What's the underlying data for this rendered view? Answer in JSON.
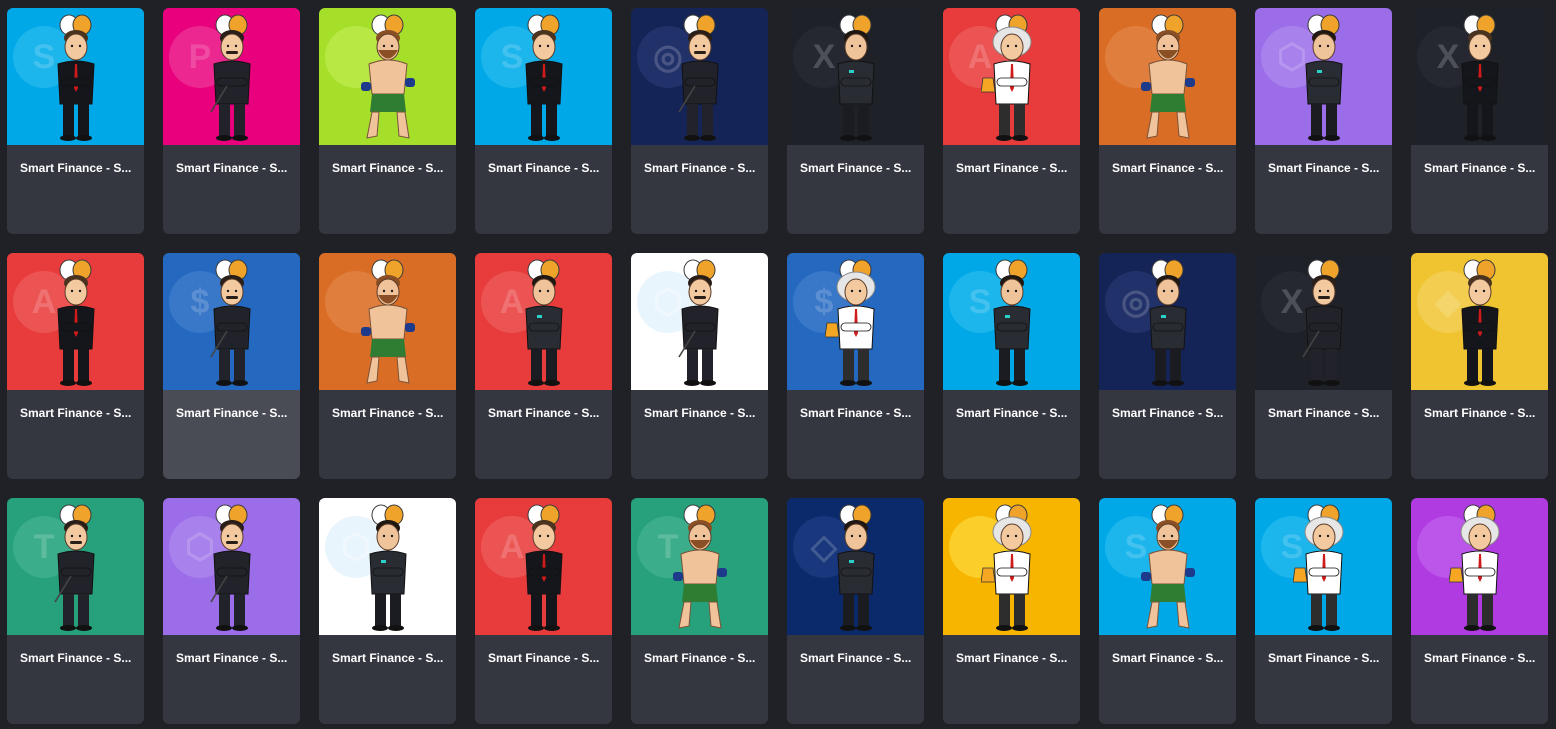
{
  "grid": {
    "title_text": "Smart Finance - S...",
    "items": [
      {
        "bg": "#00a8e8",
        "glow": "#33c2f0",
        "coin": "S",
        "character": "elon",
        "skin": "#f3c9a0",
        "hair": "#4a3420",
        "suit": "#15161b",
        "pants": "#15161b",
        "accent": "#d11a1a"
      },
      {
        "bg": "#e8007d",
        "glow": "#f04aa1",
        "coin": "P",
        "character": "businessman",
        "skin": "#f3c9a0",
        "hair": "#2a1f18",
        "suit": "#22232a",
        "pants": "#22232a",
        "accent": "#1a1a1a"
      },
      {
        "bg": "#a6df2a",
        "glow": "#c5ef59",
        "coin": "",
        "character": "fighter",
        "skin": "#f1c39a",
        "hair": "#8a4f24",
        "suit": "#f1c39a",
        "pants": "#2e7d32",
        "accent": "#1e3a8a"
      },
      {
        "bg": "#00a8e8",
        "glow": "#33c2f0",
        "coin": "S",
        "character": "elon",
        "skin": "#f3c9a0",
        "hair": "#4a3420",
        "suit": "#15161b",
        "pants": "#15161b",
        "accent": "#d11a1a"
      },
      {
        "bg": "#152456",
        "glow": "#2b3d7a",
        "coin": "◎",
        "character": "businessman",
        "skin": "#f3c9a0",
        "hair": "#2a1f18",
        "suit": "#22232a",
        "pants": "#22232a",
        "accent": "#1a1a1a"
      },
      {
        "bg": "#1e2128",
        "glow": "#2b2f37",
        "coin": "X",
        "character": "tech",
        "skin": "#f0c49b",
        "hair": "#1f1712",
        "suit": "#2a2c33",
        "pants": "#1b1c21",
        "accent": "#5f6670"
      },
      {
        "bg": "#e83b3b",
        "glow": "#f06a6a",
        "coin": "A",
        "character": "scientist",
        "skin": "#f3c9a0",
        "hair": "#e6e6e6",
        "suit": "#ffffff",
        "pants": "#2d2d2d",
        "accent": "#d11a1a"
      },
      {
        "bg": "#d96d26",
        "glow": "#e58d52",
        "coin": "",
        "character": "fighter",
        "skin": "#f1c39a",
        "hair": "#8a4f24",
        "suit": "#f1c39a",
        "pants": "#2e7d32",
        "accent": "#1e3a8a"
      },
      {
        "bg": "#9b6de8",
        "glow": "#b392f0",
        "coin": "⬡",
        "character": "tech",
        "skin": "#f0c49b",
        "hair": "#1f1712",
        "suit": "#2a2c33",
        "pants": "#1b1c21",
        "accent": "#5f6670"
      },
      {
        "bg": "#1e2128",
        "glow": "#2b2f37",
        "coin": "X",
        "character": "elon",
        "skin": "#f3c9a0",
        "hair": "#4a3420",
        "suit": "#15161b",
        "pants": "#15161b",
        "accent": "#d11a1a"
      },
      {
        "bg": "#e83b3b",
        "glow": "#f06a6a",
        "coin": "A",
        "character": "elon",
        "skin": "#f3c9a0",
        "hair": "#4a3420",
        "suit": "#15161b",
        "pants": "#15161b",
        "accent": "#d11a1a"
      },
      {
        "bg": "#2468bf",
        "glow": "#4b86d1",
        "coin": "$",
        "character": "businessman",
        "skin": "#f3c9a0",
        "hair": "#2a1f18",
        "suit": "#22232a",
        "pants": "#22232a",
        "accent": "#1a1a1a"
      },
      {
        "bg": "#d96d26",
        "glow": "#e58d52",
        "coin": "",
        "character": "fighter",
        "skin": "#f1c39a",
        "hair": "#8a4f24",
        "suit": "#f1c39a",
        "pants": "#2e7d32",
        "accent": "#1e3a8a"
      },
      {
        "bg": "#e83b3b",
        "glow": "#f06a6a",
        "coin": "A",
        "character": "tech",
        "skin": "#f0c49b",
        "hair": "#1f1712",
        "suit": "#2a2c33",
        "pants": "#1b1c21",
        "accent": "#5f6670"
      },
      {
        "bg": "#ffffff",
        "glow": "#d7eefb",
        "coin": "⬡",
        "character": "businessman",
        "skin": "#f3c9a0",
        "hair": "#2a1f18",
        "suit": "#22232a",
        "pants": "#22232a",
        "accent": "#1a1a1a"
      },
      {
        "bg": "#2468bf",
        "glow": "#4b86d1",
        "coin": "$",
        "character": "scientist",
        "skin": "#f3c9a0",
        "hair": "#e6e6e6",
        "suit": "#ffffff",
        "pants": "#2d2d2d",
        "accent": "#d11a1a"
      },
      {
        "bg": "#00a8e8",
        "glow": "#33c2f0",
        "coin": "S",
        "character": "tech",
        "skin": "#f0c49b",
        "hair": "#1f1712",
        "suit": "#2a2c33",
        "pants": "#1b1c21",
        "accent": "#5f6670"
      },
      {
        "bg": "#152456",
        "glow": "#2b3d7a",
        "coin": "◎",
        "character": "tech",
        "skin": "#f0c49b",
        "hair": "#1f1712",
        "suit": "#2a2c33",
        "pants": "#1b1c21",
        "accent": "#5f6670"
      },
      {
        "bg": "#1e2128",
        "glow": "#2b2f37",
        "coin": "X",
        "character": "businessman",
        "skin": "#f3c9a0",
        "hair": "#2a1f18",
        "suit": "#22232a",
        "pants": "#22232a",
        "accent": "#1a1a1a"
      },
      {
        "bg": "#f0c430",
        "glow": "#f5d66b",
        "coin": "◆",
        "character": "elon",
        "skin": "#f3c9a0",
        "hair": "#4a3420",
        "suit": "#15161b",
        "pants": "#15161b",
        "accent": "#d11a1a"
      },
      {
        "bg": "#26a17b",
        "glow": "#4db897",
        "coin": "T",
        "character": "businessman",
        "skin": "#f3c9a0",
        "hair": "#2a1f18",
        "suit": "#22232a",
        "pants": "#22232a",
        "accent": "#1a1a1a"
      },
      {
        "bg": "#9b6de8",
        "glow": "#b392f0",
        "coin": "⬡",
        "character": "businessman",
        "skin": "#f3c9a0",
        "hair": "#2a1f18",
        "suit": "#22232a",
        "pants": "#22232a",
        "accent": "#1a1a1a"
      },
      {
        "bg": "#ffffff",
        "glow": "#d7eefb",
        "coin": "⬡",
        "character": "tech",
        "skin": "#f0c49b",
        "hair": "#1f1712",
        "suit": "#2a2c33",
        "pants": "#1b1c21",
        "accent": "#5f6670"
      },
      {
        "bg": "#e83b3b",
        "glow": "#f06a6a",
        "coin": "A",
        "character": "elon",
        "skin": "#f3c9a0",
        "hair": "#4a3420",
        "suit": "#15161b",
        "pants": "#15161b",
        "accent": "#d11a1a"
      },
      {
        "bg": "#26a17b",
        "glow": "#4db897",
        "coin": "T",
        "character": "fighter",
        "skin": "#f1c39a",
        "hair": "#8a4f24",
        "suit": "#f1c39a",
        "pants": "#2e7d32",
        "accent": "#1e3a8a"
      },
      {
        "bg": "#0b2a6b",
        "glow": "#24438a",
        "coin": "◇",
        "character": "tech",
        "skin": "#f0c49b",
        "hair": "#1f1712",
        "suit": "#2a2c33",
        "pants": "#1b1c21",
        "accent": "#5f6670"
      },
      {
        "bg": "#f7b500",
        "glow": "#ffe14d",
        "coin": "",
        "character": "scientist",
        "skin": "#f3c9a0",
        "hair": "#e6e6e6",
        "suit": "#ffffff",
        "pants": "#2d2d2d",
        "accent": "#d11a1a"
      },
      {
        "bg": "#00a8e8",
        "glow": "#33c2f0",
        "coin": "S",
        "character": "fighter",
        "skin": "#f1c39a",
        "hair": "#8a4f24",
        "suit": "#f1c39a",
        "pants": "#2e7d32",
        "accent": "#1e3a8a"
      },
      {
        "bg": "#00a8e8",
        "glow": "#33c2f0",
        "coin": "S",
        "character": "scientist",
        "skin": "#f3c9a0",
        "hair": "#e6e6e6",
        "suit": "#ffffff",
        "pants": "#2d2d2d",
        "accent": "#d11a1a"
      },
      {
        "bg": "#b03be0",
        "glow": "#c76cf0",
        "coin": "",
        "character": "scientist",
        "skin": "#f3c9a0",
        "hair": "#e6e6e6",
        "suit": "#ffffff",
        "pants": "#2d2d2d",
        "accent": "#d11a1a"
      }
    ]
  }
}
